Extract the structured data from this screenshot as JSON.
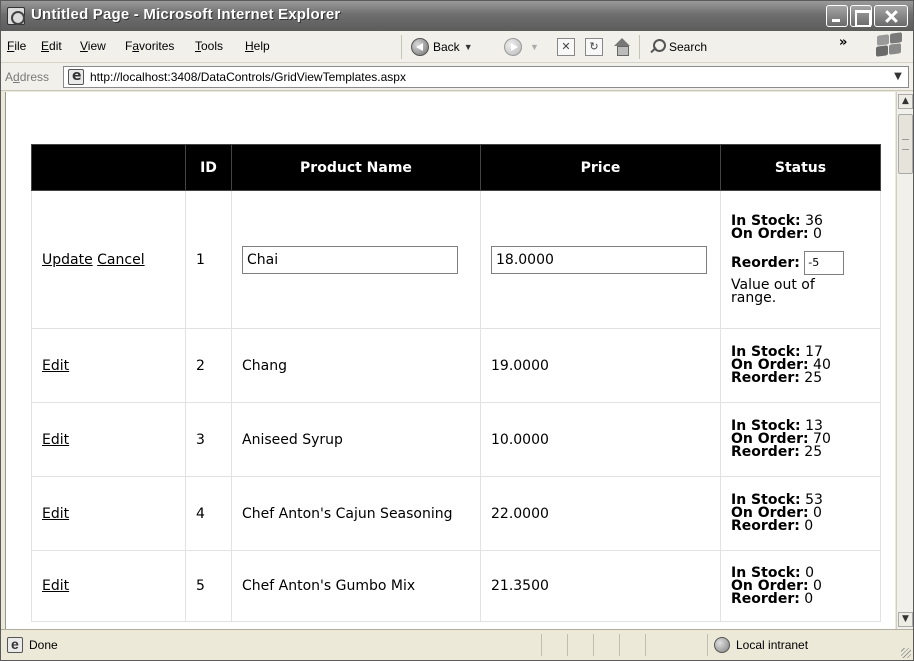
{
  "window": {
    "title": "Untitled Page - Microsoft Internet Explorer"
  },
  "menu": {
    "items": [
      {
        "mnemonic": "F",
        "rest": "ile"
      },
      {
        "mnemonic": "E",
        "rest": "dit"
      },
      {
        "mnemonic": "V",
        "rest": "iew"
      },
      {
        "pre": "F",
        "mnemonic": "a",
        "rest": "vorites"
      },
      {
        "mnemonic": "T",
        "rest": "ools"
      },
      {
        "mnemonic": "H",
        "rest": "elp"
      }
    ]
  },
  "toolbar": {
    "back_label": "Back",
    "search_label": "Search",
    "more": "»"
  },
  "address": {
    "label_pre": "A",
    "label_mnemonic": "d",
    "label_rest": "dress",
    "url": "http://localhost:3408/DataControls/GridViewTemplates.aspx"
  },
  "grid": {
    "headers": {
      "actions": "",
      "id": "ID",
      "name": "Product Name",
      "price": "Price",
      "status": "Status"
    },
    "labels": {
      "in_stock": "In Stock:",
      "on_order": "On Order:",
      "reorder": "Reorder:"
    },
    "edit_row": {
      "update_label": "Update",
      "cancel_label": "Cancel",
      "id": "1",
      "name_value": "Chai",
      "price_value": "18.0000",
      "in_stock": "36",
      "on_order": "0",
      "reorder_value": "-5",
      "error": "Value out of range."
    },
    "rows": [
      {
        "action": "Edit",
        "id": "2",
        "name": "Chang",
        "price": "19.0000",
        "in_stock": "17",
        "on_order": "40",
        "reorder": "25"
      },
      {
        "action": "Edit",
        "id": "3",
        "name": "Aniseed Syrup",
        "price": "10.0000",
        "in_stock": "13",
        "on_order": "70",
        "reorder": "25"
      },
      {
        "action": "Edit",
        "id": "4",
        "name": "Chef Anton's Cajun Seasoning",
        "price": "22.0000",
        "in_stock": "53",
        "on_order": "0",
        "reorder": "0"
      },
      {
        "action": "Edit",
        "id": "5",
        "name": "Chef Anton's Gumbo Mix",
        "price": "21.3500",
        "in_stock": "0",
        "on_order": "0",
        "reorder": "0"
      }
    ]
  },
  "statusbar": {
    "text": "Done",
    "zone": "Local intranet"
  }
}
